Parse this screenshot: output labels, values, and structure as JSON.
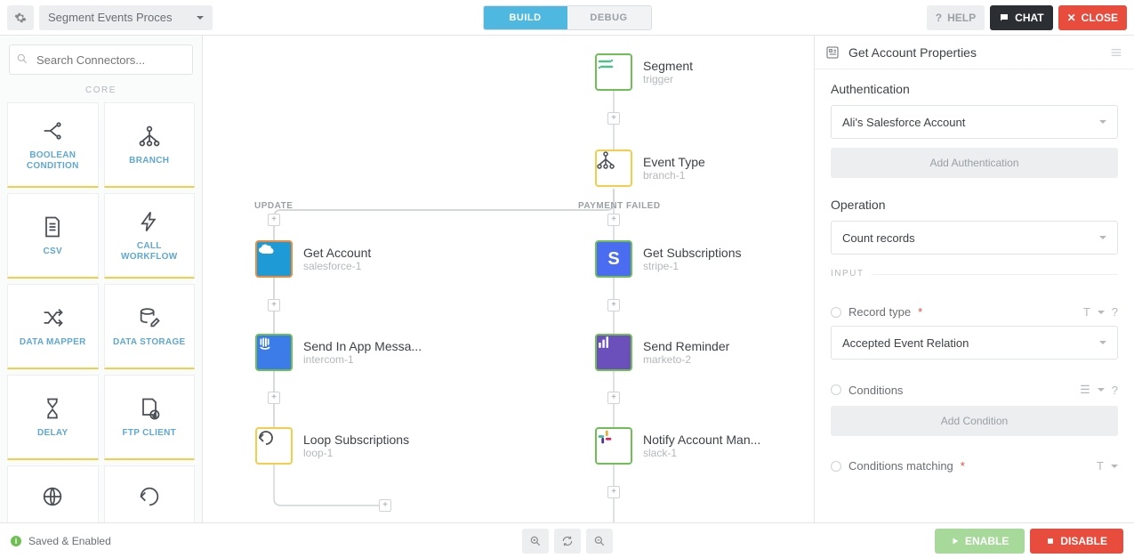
{
  "topbar": {
    "workflow_name": "Segment Events Proces",
    "tabs": {
      "build": "BUILD",
      "debug": "DEBUG"
    },
    "help": "HELP",
    "chat": "CHAT",
    "close": "CLOSE"
  },
  "sidebar": {
    "search_placeholder": "Search Connectors...",
    "category": "CORE",
    "connectors": [
      {
        "label": "BOOLEAN CONDITION",
        "icon": "branch-split"
      },
      {
        "label": "BRANCH",
        "icon": "tree"
      },
      {
        "label": "CSV",
        "icon": "csv-file"
      },
      {
        "label": "CALL WORKFLOW",
        "icon": "bolt"
      },
      {
        "label": "DATA MAPPER",
        "icon": "shuffle"
      },
      {
        "label": "DATA STORAGE",
        "icon": "db-edit"
      },
      {
        "label": "DELAY",
        "icon": "hourglass"
      },
      {
        "label": "FTP CLIENT",
        "icon": "file-down"
      },
      {
        "label": "",
        "icon": "globe"
      },
      {
        "label": "",
        "icon": "loop"
      }
    ]
  },
  "canvas": {
    "nodes": {
      "segment": {
        "title": "Segment",
        "sub": "trigger"
      },
      "eventtype": {
        "title": "Event Type",
        "sub": "branch-1"
      },
      "getacct": {
        "title": "Get Account",
        "sub": "salesforce-1"
      },
      "sendapp": {
        "title": "Send In App Messa...",
        "sub": "intercom-1"
      },
      "loop": {
        "title": "Loop Subscriptions",
        "sub": "loop-1"
      },
      "getsub": {
        "title": "Get Subscriptions",
        "sub": "stripe-1"
      },
      "reminder": {
        "title": "Send Reminder",
        "sub": "marketo-2"
      },
      "notify": {
        "title": "Notify Account Man...",
        "sub": "slack-1"
      }
    },
    "branches": {
      "left": "UPDATE",
      "right": "PAYMENT FAILED"
    }
  },
  "panel": {
    "title": "Get Account Properties",
    "auth_label": "Authentication",
    "auth_value": "Ali's Salesforce Account",
    "add_auth": "Add Authentication",
    "op_label": "Operation",
    "op_value": "Count records",
    "input_divider": "INPUT",
    "record_type_label": "Record type",
    "record_type_value": "Accepted Event Relation",
    "conditions_label": "Conditions",
    "add_condition": "Add Condition",
    "conditions_matching_label": "Conditions matching"
  },
  "statusbar": {
    "status": "Saved & Enabled",
    "enable": "ENABLE",
    "disable": "DISABLE"
  }
}
